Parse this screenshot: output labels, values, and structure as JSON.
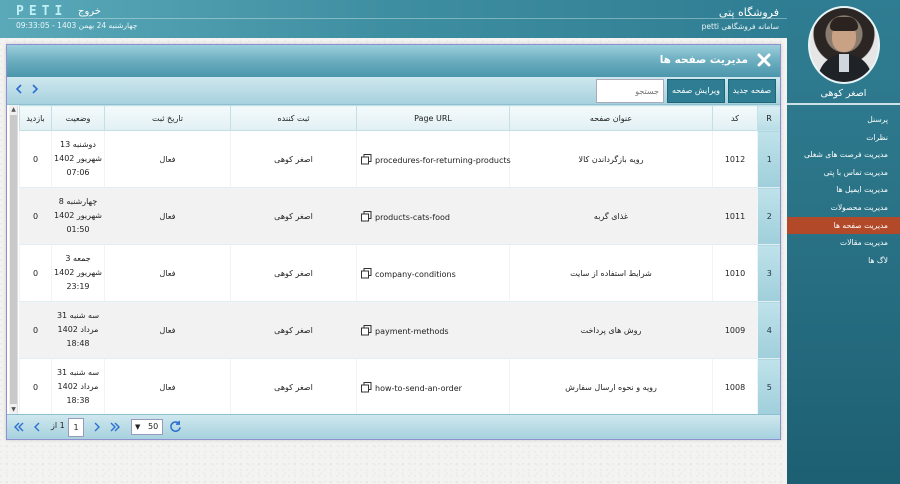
{
  "header": {
    "store_title": "فروشگاه پتی",
    "store_subtitle": "سامانه فروشگاهی petti",
    "logo": "PETI",
    "exit_label": "خروج",
    "datetime": "چهارشنبه 24 بهمن 1403 - 09:33:05"
  },
  "sidebar": {
    "username": "اصغر کوهی",
    "items": [
      {
        "label": "پرسنل",
        "active": false
      },
      {
        "label": "نظرات",
        "active": false
      },
      {
        "label": "مدیریت فرصت های شغلی",
        "active": false
      },
      {
        "label": "مدیریت تماس با پتی",
        "active": false
      },
      {
        "label": "مدیریت ایمیل ها",
        "active": false
      },
      {
        "label": "مدیریت محصولات",
        "active": false
      },
      {
        "label": "مدیریت صفحه ها",
        "active": true
      },
      {
        "label": "مدیریت مقالات",
        "active": false
      },
      {
        "label": "لاگ ها",
        "active": false
      }
    ],
    "active_color": "#b24a2a"
  },
  "panel": {
    "title": "مدیریت صفحه ها",
    "new_page_label": "صفحه جدید",
    "edit_page_label": "ویرایش صفحه",
    "search_placeholder": "جستجو"
  },
  "table": {
    "columns": {
      "r": "R",
      "code": "کد",
      "title": "عنوان صفحه",
      "url": "Page URL",
      "registrar": "ثبت کننده",
      "reg_date": "تاریخ ثبت",
      "status": "وضعیت",
      "visits": "بازدید"
    },
    "rows": [
      {
        "r": "1",
        "code": "1012",
        "title": "رویه بازگرداندن کالا",
        "url": "procedures-for-returning-products",
        "registrar": "اصغر کوهی",
        "reg_date": "فعال",
        "status_lines": [
          "دوشنبه 13",
          "شهریور 1402",
          "07:06"
        ],
        "visits": "0"
      },
      {
        "r": "2",
        "code": "1011",
        "title": "غذای گربه",
        "url": "products-cats-food",
        "registrar": "اصغر کوهی",
        "reg_date": "فعال",
        "status_lines": [
          "چهارشنبه 8",
          "شهریور 1402",
          "01:50"
        ],
        "visits": "0"
      },
      {
        "r": "3",
        "code": "1010",
        "title": "شرایط استفاده از سایت",
        "url": "company-conditions",
        "registrar": "اصغر کوهی",
        "reg_date": "فعال",
        "status_lines": [
          "جمعه 3",
          "شهریور 1402",
          "23:19"
        ],
        "visits": "0"
      },
      {
        "r": "4",
        "code": "1009",
        "title": "روش های پرداخت",
        "url": "payment-methods",
        "registrar": "اصغر کوهی",
        "reg_date": "فعال",
        "status_lines": [
          "سه شنبه 31",
          "مرداد 1402",
          "18:48"
        ],
        "visits": "0"
      },
      {
        "r": "5",
        "code": "1008",
        "title": "رویه و نحوه ارسال سفارش",
        "url": "how-to-send-an-order",
        "registrar": "اصغر کوهی",
        "reg_date": "فعال",
        "status_lines": [
          "سه شنبه 31",
          "مرداد 1402",
          "18:38"
        ],
        "visits": "0"
      }
    ]
  },
  "pager": {
    "current_page": "1",
    "of_label": "از",
    "total_pages": "1",
    "page_size": "50"
  }
}
